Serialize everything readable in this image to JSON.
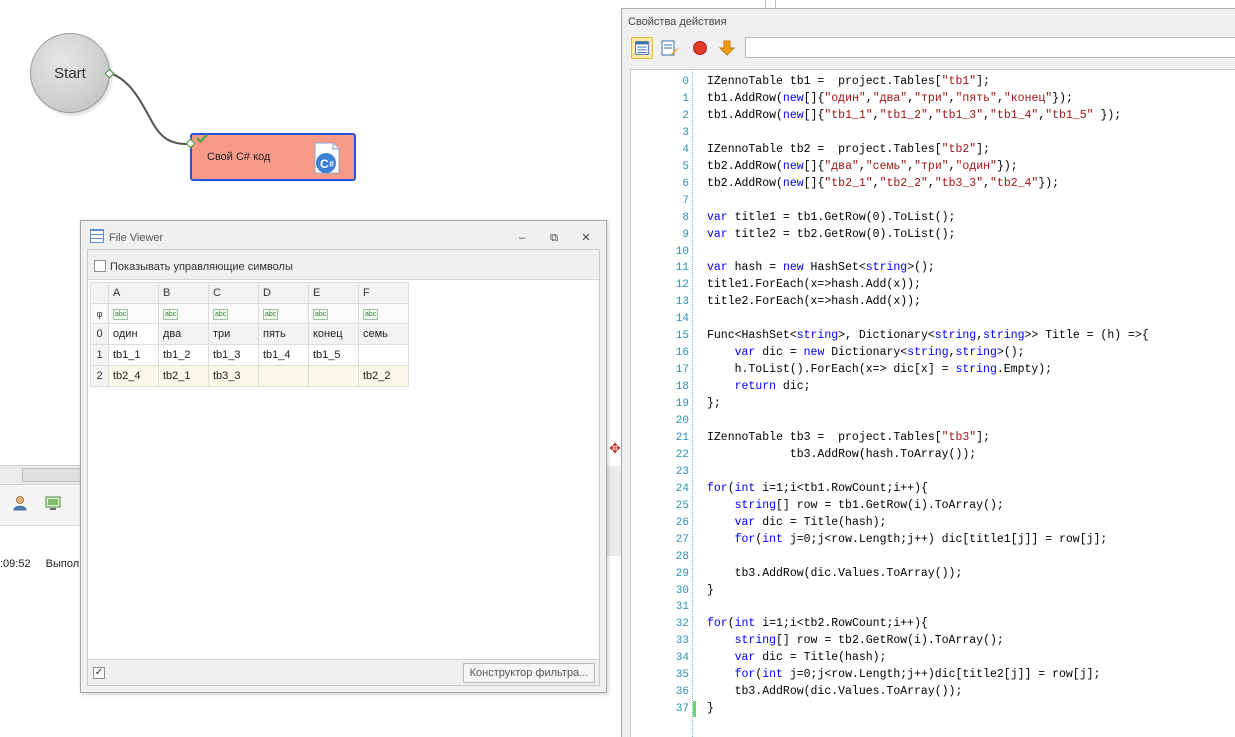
{
  "canvas": {
    "start_label": "Start",
    "action_label": "Свой C# код",
    "action_icon": "csharp-icon"
  },
  "background_panel": {
    "log_time": ":09:52",
    "log_text": "Выпол"
  },
  "file_viewer": {
    "title": "File Viewer",
    "show_control_chars": "Показывать управляющие символы",
    "filter_button": "Конструктор фильтра...",
    "column_headers": [
      "A",
      "B",
      "C",
      "D",
      "E",
      "F"
    ],
    "filter_row_icon": "φ",
    "type_icon_text": "abc",
    "row_numbers": [
      "0",
      "1",
      "2"
    ],
    "rows": [
      [
        "один",
        "два",
        "три",
        "пять",
        "конец",
        "семь"
      ],
      [
        "tb1_1",
        "tb1_2",
        "tb1_3",
        "tb1_4",
        "tb1_5",
        ""
      ],
      [
        "tb2_4",
        "tb2_1",
        "tb3_3",
        "",
        "",
        "tb2_2"
      ]
    ]
  },
  "properties": {
    "title": "Свойства действия",
    "colors": {
      "keyword": "#0000ff",
      "string": "#a31515",
      "line_number": "#2b91af",
      "accent_node": "#f79a88"
    },
    "code_lines": [
      [
        {
          "t": "IZennoTable tb1 =  project.Tables["
        },
        {
          "s": "\"tb1\""
        },
        {
          "t": "];"
        }
      ],
      [
        {
          "t": "tb1.AddRow("
        },
        {
          "k": "new"
        },
        {
          "t": "[]{"
        },
        {
          "s": "\"один\""
        },
        {
          "t": ","
        },
        {
          "s": "\"два\""
        },
        {
          "t": ","
        },
        {
          "s": "\"три\""
        },
        {
          "t": ","
        },
        {
          "s": "\"пять\""
        },
        {
          "t": ","
        },
        {
          "s": "\"конец\""
        },
        {
          "t": "});"
        }
      ],
      [
        {
          "t": "tb1.AddRow("
        },
        {
          "k": "new"
        },
        {
          "t": "[]{"
        },
        {
          "s": "\"tb1_1\""
        },
        {
          "t": ","
        },
        {
          "s": "\"tb1_2\""
        },
        {
          "t": ","
        },
        {
          "s": "\"tb1_3\""
        },
        {
          "t": ","
        },
        {
          "s": "\"tb1_4\""
        },
        {
          "t": ","
        },
        {
          "s": "\"tb1_5\""
        },
        {
          "t": " });"
        }
      ],
      [],
      [
        {
          "t": "IZennoTable tb2 =  project.Tables["
        },
        {
          "s": "\"tb2\""
        },
        {
          "t": "];"
        }
      ],
      [
        {
          "t": "tb2.AddRow("
        },
        {
          "k": "new"
        },
        {
          "t": "[]{"
        },
        {
          "s": "\"два\""
        },
        {
          "t": ","
        },
        {
          "s": "\"семь\""
        },
        {
          "t": ","
        },
        {
          "s": "\"три\""
        },
        {
          "t": ","
        },
        {
          "s": "\"один\""
        },
        {
          "t": "});"
        }
      ],
      [
        {
          "t": "tb2.AddRow("
        },
        {
          "k": "new"
        },
        {
          "t": "[]{"
        },
        {
          "s": "\"tb2_1\""
        },
        {
          "t": ","
        },
        {
          "s": "\"tb2_2\""
        },
        {
          "t": ","
        },
        {
          "s": "\"tb3_3\""
        },
        {
          "t": ","
        },
        {
          "s": "\"tb2_4\""
        },
        {
          "t": "});"
        }
      ],
      [],
      [
        {
          "k": "var"
        },
        {
          "t": " title1 = tb1.GetRow(0).ToList();"
        }
      ],
      [
        {
          "k": "var"
        },
        {
          "t": " title2 = tb2.GetRow(0).ToList();"
        }
      ],
      [],
      [
        {
          "k": "var"
        },
        {
          "t": " hash = "
        },
        {
          "k": "new"
        },
        {
          "t": " HashSet<"
        },
        {
          "k": "string"
        },
        {
          "t": ">();"
        }
      ],
      [
        {
          "t": "title1.ForEach(x=>hash.Add(x));"
        }
      ],
      [
        {
          "t": "title2.ForEach(x=>hash.Add(x));"
        }
      ],
      [],
      [
        {
          "t": "Func<HashSet<"
        },
        {
          "k": "string"
        },
        {
          "t": ">, Dictionary<"
        },
        {
          "k": "string"
        },
        {
          "t": ","
        },
        {
          "k": "string"
        },
        {
          "t": ">> Title = (h) =>{"
        }
      ],
      [
        {
          "t": "    "
        },
        {
          "k": "var"
        },
        {
          "t": " dic = "
        },
        {
          "k": "new"
        },
        {
          "t": " Dictionary<"
        },
        {
          "k": "string"
        },
        {
          "t": ","
        },
        {
          "k": "string"
        },
        {
          "t": ">();"
        }
      ],
      [
        {
          "t": "    h.ToList().ForEach(x=> dic[x] = "
        },
        {
          "k": "string"
        },
        {
          "t": ".Empty);"
        }
      ],
      [
        {
          "t": "    "
        },
        {
          "k": "return"
        },
        {
          "t": " dic;"
        }
      ],
      [
        {
          "t": "};"
        }
      ],
      [],
      [
        {
          "t": "IZennoTable tb3 =  project.Tables["
        },
        {
          "s": "\"tb3\""
        },
        {
          "t": "];"
        }
      ],
      [
        {
          "t": "            tb3.AddRow(hash.ToArray());"
        }
      ],
      [],
      [
        {
          "k": "for"
        },
        {
          "t": "("
        },
        {
          "k": "int"
        },
        {
          "t": " i=1;i<tb1.RowCount;i++){"
        }
      ],
      [
        {
          "t": "    "
        },
        {
          "k": "string"
        },
        {
          "t": "[] row = tb1.GetRow(i).ToArray();"
        }
      ],
      [
        {
          "t": "    "
        },
        {
          "k": "var"
        },
        {
          "t": " dic = Title(hash);"
        }
      ],
      [
        {
          "t": "    "
        },
        {
          "k": "for"
        },
        {
          "t": "("
        },
        {
          "k": "int"
        },
        {
          "t": " j=0;j<row.Length;j++) dic[title1[j]] = row[j];"
        }
      ],
      [],
      [
        {
          "t": "    tb3.AddRow(dic.Values.ToArray());"
        }
      ],
      [
        {
          "t": "}"
        }
      ],
      [],
      [
        {
          "k": "for"
        },
        {
          "t": "("
        },
        {
          "k": "int"
        },
        {
          "t": " i=1;i<tb2.RowCount;i++){"
        }
      ],
      [
        {
          "t": "    "
        },
        {
          "k": "string"
        },
        {
          "t": "[] row = tb2.GetRow(i).ToArray();"
        }
      ],
      [
        {
          "t": "    "
        },
        {
          "k": "var"
        },
        {
          "t": " dic = Title(hash);"
        }
      ],
      [
        {
          "t": "    "
        },
        {
          "k": "for"
        },
        {
          "t": "("
        },
        {
          "k": "int"
        },
        {
          "t": " j=0;j<row.Length;j++)dic[title2[j]] = row[j];"
        }
      ],
      [
        {
          "t": "    tb3.AddRow(dic.Values.ToArray());"
        }
      ],
      [
        {
          "t": "}"
        }
      ]
    ]
  }
}
